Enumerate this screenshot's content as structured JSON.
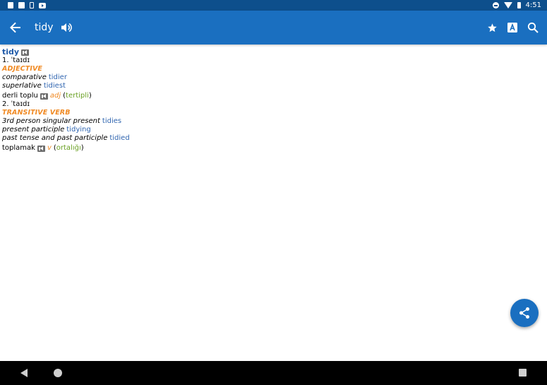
{
  "status_bar": {
    "time": "4:51",
    "left_icons": [
      "sim-icon",
      "photo-icon",
      "phone-icon",
      "youtube-icon"
    ],
    "right_icons": [
      "dnd-icon",
      "wifi-icon",
      "battery-icon"
    ]
  },
  "app_bar": {
    "title": "tidy",
    "icons": [
      "back-arrow-icon",
      "speaker-icon",
      "star-icon",
      "font-icon",
      "search-icon"
    ],
    "color": "#1a6fc0"
  },
  "entry": {
    "headword": "tidy",
    "sense1": {
      "number": "1.",
      "pronunciation": "ˈtaɪdɪ",
      "pos": "ADJECTIVE",
      "forms": [
        {
          "label": "comparative",
          "value": "tidier"
        },
        {
          "label": "superlative",
          "value": "tidiest"
        }
      ],
      "translation": "derli toplu",
      "trans_pos": "adj",
      "trans_note_open": "(",
      "trans_note": "tertipli",
      "trans_note_close": ")"
    },
    "sense2": {
      "number": "2.",
      "pronunciation": "ˈtaɪdɪ",
      "pos": "TRANSITIVE VERB",
      "forms": [
        {
          "label": "3rd person singular present",
          "value": "tidies"
        },
        {
          "label": "present participle",
          "value": "tidying"
        },
        {
          "label": "past tense and past participle",
          "value": "tidied"
        }
      ],
      "translation": "toplamak",
      "trans_pos": "v",
      "trans_note_open": "(",
      "trans_note": "ortalığı",
      "trans_note_close": ")"
    }
  },
  "fab": {
    "icon": "share-icon"
  },
  "colors": {
    "headword": "#1f5aa8",
    "pos": "#f08a24",
    "link": "#3166b0",
    "note": "#6aa024"
  }
}
